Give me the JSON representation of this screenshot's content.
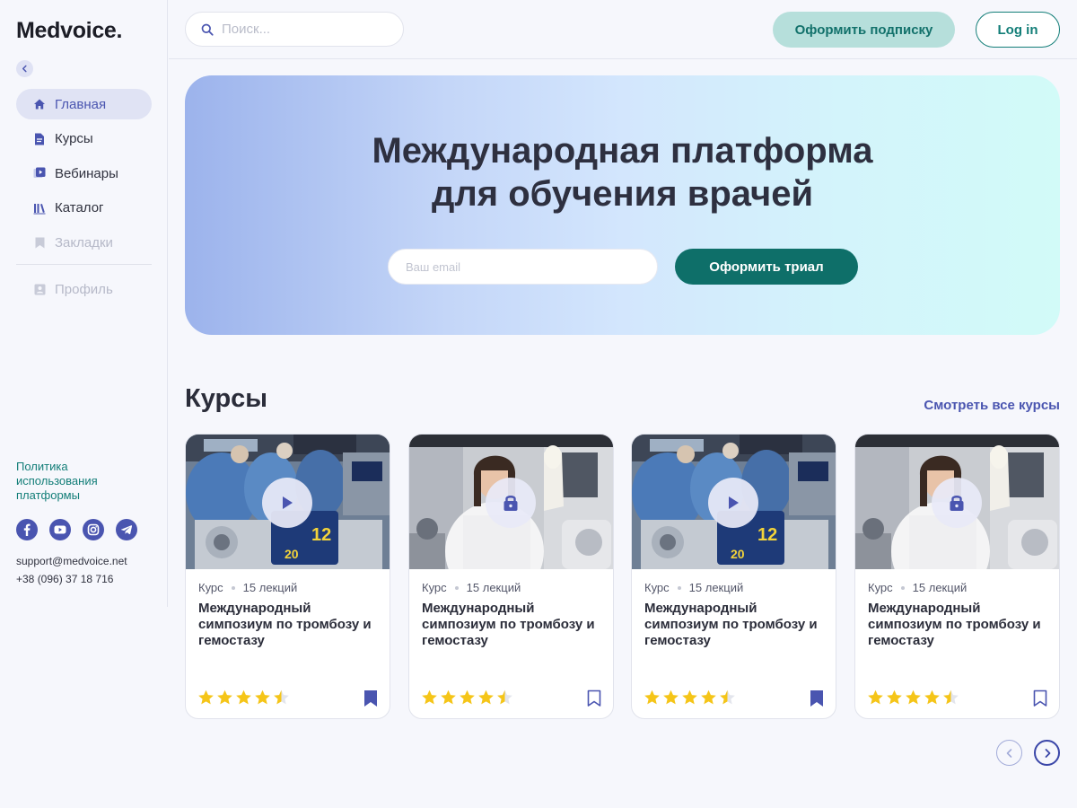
{
  "sidebar": {
    "logo": "Medvoice.",
    "nav": [
      {
        "label": "Главная",
        "icon": "home-icon",
        "state": "active"
      },
      {
        "label": "Курсы",
        "icon": "document-icon",
        "state": "normal"
      },
      {
        "label": "Вебинары",
        "icon": "video-icon",
        "state": "normal"
      },
      {
        "label": "Каталог",
        "icon": "library-icon",
        "state": "normal"
      },
      {
        "label": "Закладки",
        "icon": "bookmark-icon",
        "state": "disabled"
      },
      {
        "label": "Профиль",
        "icon": "profile-icon",
        "state": "disabled"
      }
    ],
    "policy": "Политика использования платформы",
    "socials": [
      "facebook-icon",
      "youtube-icon",
      "instagram-icon",
      "telegram-icon"
    ],
    "email": "support@medvoice.net",
    "phone": "+38 (096) 37 18 716"
  },
  "header": {
    "search_placeholder": "Поиск...",
    "subscribe_label": "Оформить подписку",
    "login_label": "Log in"
  },
  "hero": {
    "title_line1": "Международная платформа",
    "title_line2": "для обучения врачей",
    "email_placeholder": "Ваш email",
    "cta_label": "Оформить триал"
  },
  "courses": {
    "title": "Курсы",
    "see_all": "Смотреть все курсы",
    "items": [
      {
        "type": "Курс",
        "lectures": "15 лекций",
        "title": "Международный симпозиум по тромбозу и гемостазу",
        "rating": 4.5,
        "overlay": "play-icon",
        "bookmarked": true
      },
      {
        "type": "Курс",
        "lectures": "15 лекций",
        "title": "Международный симпозиум по тромбозу и гемостазу",
        "rating": 4.5,
        "overlay": "lock-icon",
        "bookmarked": false
      },
      {
        "type": "Курс",
        "lectures": "15 лекций",
        "title": "Международный симпозиум по тромбозу и гемостазу",
        "rating": 4.5,
        "overlay": "play-icon",
        "bookmarked": true
      },
      {
        "type": "Курс",
        "lectures": "15 лекций",
        "title": "Международный симпозиум по тромбозу и гемостазу",
        "rating": 4.5,
        "overlay": "lock-icon",
        "bookmarked": false
      }
    ]
  },
  "colors": {
    "accent": "#4a55b0",
    "teal": "#0e6f69",
    "star": "#f5c518"
  }
}
